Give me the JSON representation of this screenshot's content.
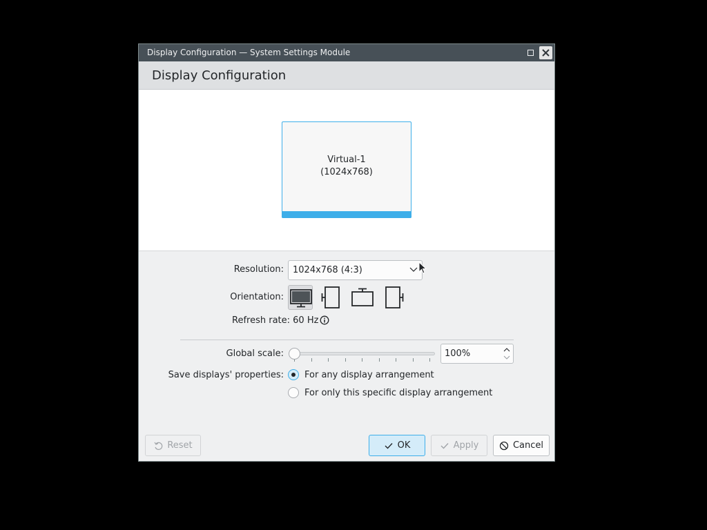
{
  "window": {
    "title": "Display Configuration — System Settings Module",
    "maximize_icon": "maximize-icon",
    "close_icon": "close-icon"
  },
  "header": {
    "title": "Display Configuration"
  },
  "monitor": {
    "name": "Virtual-1",
    "resolution": "(1024x768)",
    "accent": "#3daee9"
  },
  "settings": {
    "resolution_label": "Resolution:",
    "resolution_value": "1024x768 (4:3)",
    "orientation_label": "Orientation:",
    "orientation_options": [
      "landscape-icon",
      "portrait-left-icon",
      "landscape-flipped-icon",
      "portrait-right-icon"
    ],
    "refresh_label": "Refresh rate: 60 Hz",
    "scale_label": "Global scale:",
    "scale_value": "100%",
    "scale_slider_level": 0,
    "save_label": "Save displays' properties:",
    "save_options": [
      {
        "label": "For any display arrangement",
        "checked": true
      },
      {
        "label": "For only this specific display arrangement",
        "checked": false
      }
    ]
  },
  "buttons": {
    "reset": "Reset",
    "ok": "OK",
    "apply": "Apply",
    "cancel": "Cancel"
  }
}
